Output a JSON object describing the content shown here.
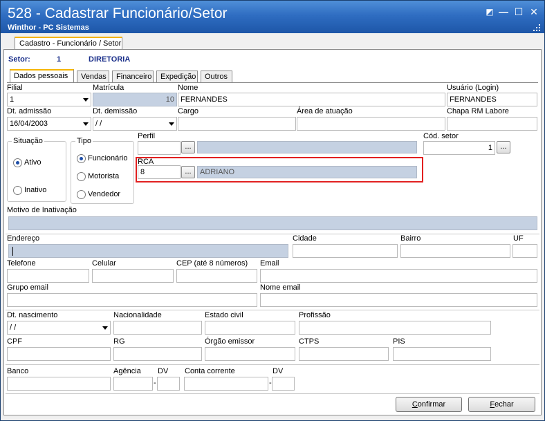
{
  "window": {
    "title": "528 - Cadastrar Funcionário/Setor",
    "subtitle": "Winthor - PC Sistemas"
  },
  "outer_tab": {
    "label": "Cadastro - Funcionário / Setor"
  },
  "setor": {
    "label": "Setor:",
    "code": "1",
    "name": "DIRETORIA"
  },
  "tabs": [
    "Dados pessoais",
    "Vendas",
    "Financeiro",
    "Expedição",
    "Outros"
  ],
  "fields": {
    "filial": {
      "label": "Filial",
      "value": "1"
    },
    "matricula": {
      "label": "Matrícula",
      "value": "10"
    },
    "nome": {
      "label": "Nome",
      "value": "FERNANDES"
    },
    "usuario": {
      "label": "Usuário (Login)",
      "value": "FERNANDES"
    },
    "dt_admissao": {
      "label": "Dt. admissão",
      "value": "16/04/2003"
    },
    "dt_demissao": {
      "label": "Dt.  demissão",
      "value": " / /"
    },
    "cargo": {
      "label": "Cargo",
      "value": ""
    },
    "area_atuacao": {
      "label": "Área de atuação",
      "value": ""
    },
    "chapa": {
      "label": "Chapa RM Labore",
      "value": ""
    },
    "perfil": {
      "label": "Perfil",
      "value": "",
      "desc": ""
    },
    "cod_setor": {
      "label": "Cód. setor",
      "value": "1"
    },
    "rca": {
      "label": "RCA",
      "value": "8",
      "desc": "ADRIANO"
    },
    "motivo_inativacao": {
      "label": "Motivo de Inativação",
      "value": ""
    },
    "endereco": {
      "label": "Endereço",
      "value": ""
    },
    "cidade": {
      "label": "Cidade",
      "value": ""
    },
    "bairro": {
      "label": "Bairro",
      "value": ""
    },
    "uf": {
      "label": "UF",
      "value": ""
    },
    "telefone": {
      "label": "Telefone",
      "value": ""
    },
    "celular": {
      "label": "Celular",
      "value": ""
    },
    "cep": {
      "label": "CEP (até 8 números)",
      "value": ""
    },
    "email": {
      "label": "Email",
      "value": ""
    },
    "grupo_email": {
      "label": "Grupo email",
      "value": ""
    },
    "nome_email": {
      "label": "Nome email",
      "value": ""
    },
    "dt_nascimento": {
      "label": "Dt. nascimento",
      "value": " / /"
    },
    "nacionalidade": {
      "label": "Nacionalidade",
      "value": ""
    },
    "estado_civil": {
      "label": "Estado civil",
      "value": ""
    },
    "profissao": {
      "label": "Profissão",
      "value": ""
    },
    "cpf": {
      "label": "CPF",
      "value": ""
    },
    "rg": {
      "label": "RG",
      "value": ""
    },
    "orgao_emissor": {
      "label": "Órgão emissor",
      "value": ""
    },
    "ctps": {
      "label": "CTPS",
      "value": ""
    },
    "pis": {
      "label": "PIS",
      "value": ""
    },
    "banco": {
      "label": "Banco",
      "value": ""
    },
    "agencia": {
      "label": "Agência",
      "value": ""
    },
    "agencia_dv": {
      "label": "DV",
      "value": ""
    },
    "conta_corrente": {
      "label": "Conta corrente",
      "value": ""
    },
    "conta_dv": {
      "label": "DV",
      "value": ""
    }
  },
  "situacao": {
    "title": "Situação",
    "options": [
      "Ativo",
      "Inativo"
    ],
    "selected": "Ativo"
  },
  "tipo": {
    "title": "Tipo",
    "options": [
      "Funcionário",
      "Motorista",
      "Vendedor"
    ],
    "selected": "Funcionário"
  },
  "ellipsis": "...",
  "dash": "-",
  "buttons": {
    "confirmar": {
      "accel": "C",
      "rest": "onfirmar"
    },
    "fechar": {
      "accel": "F",
      "rest": "echar"
    }
  },
  "colors": {
    "title_bar": "#2f6dc1",
    "readonly_field": "#c5d1e2",
    "highlight": "#e22020",
    "active_tab_accent": "#f5b400"
  }
}
